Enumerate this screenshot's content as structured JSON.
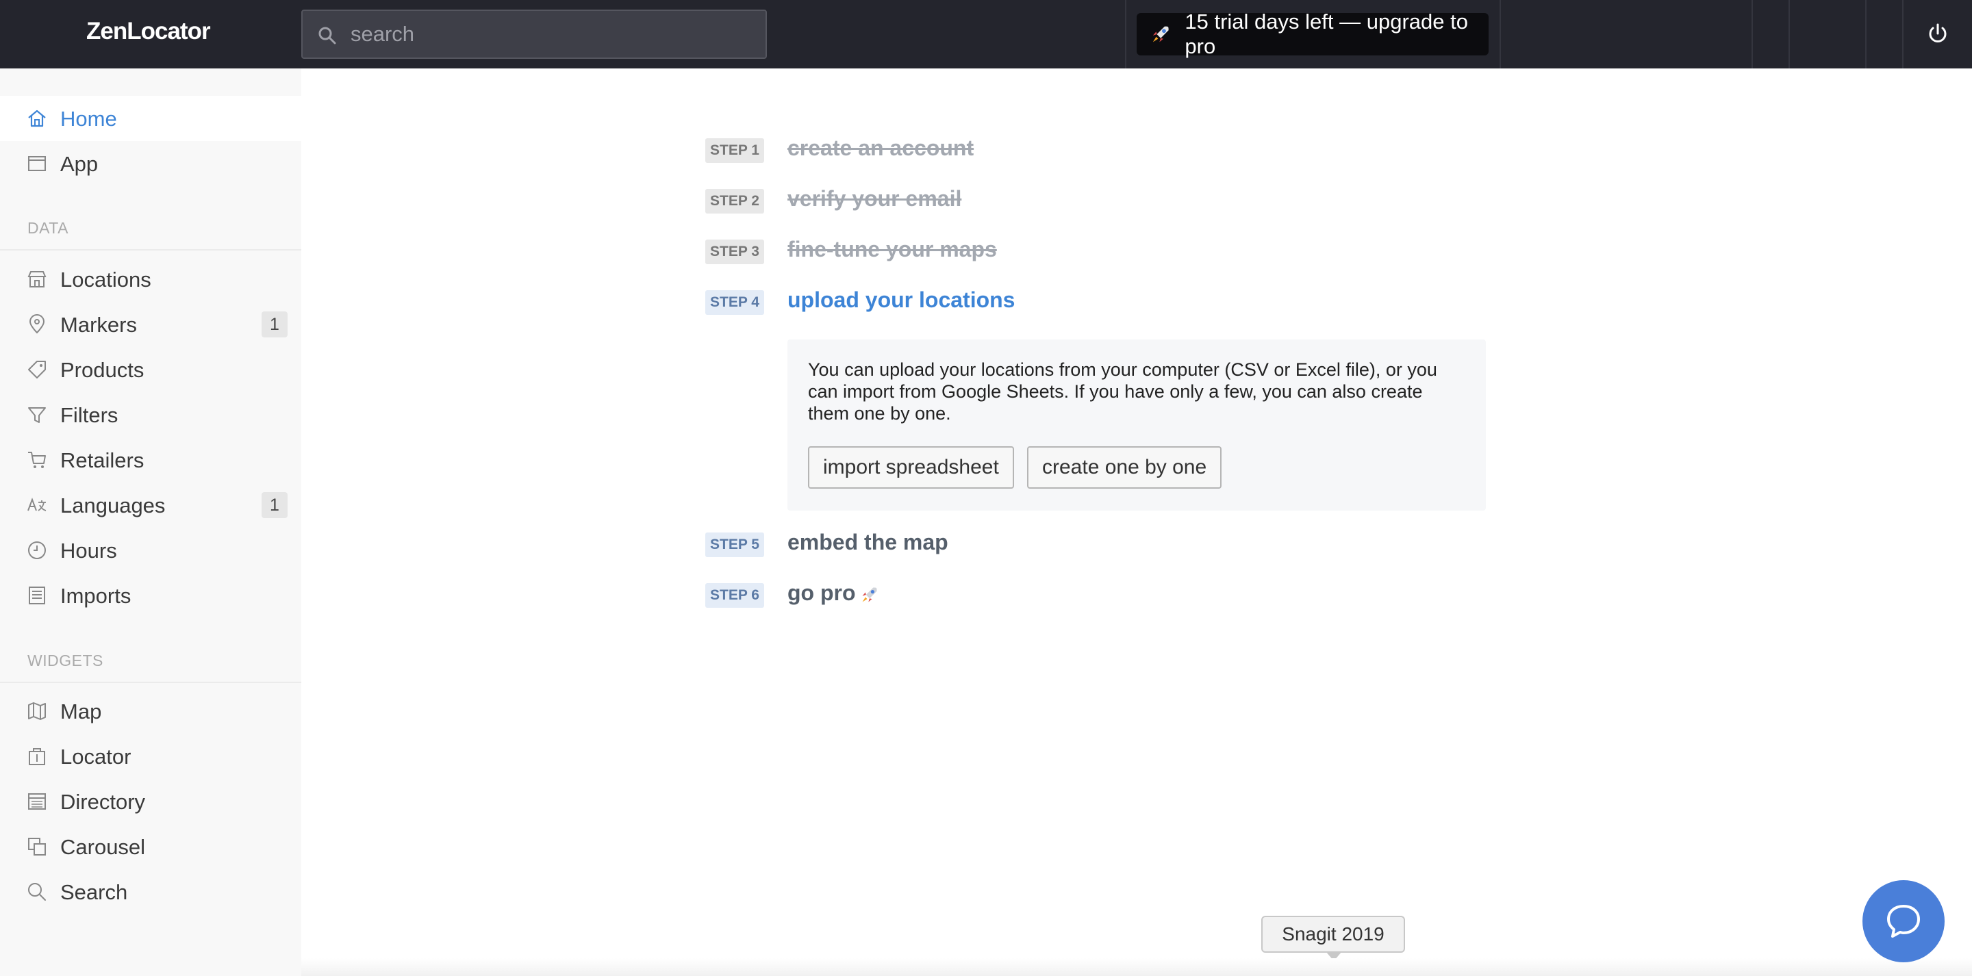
{
  "brand": "ZenLocator",
  "search": {
    "placeholder": "search"
  },
  "trial_banner": "15 trial days left — upgrade to pro",
  "sidebar": {
    "top_items": [
      {
        "label": "Home",
        "icon": "home-icon",
        "active": true
      },
      {
        "label": "App",
        "icon": "app-window-icon"
      }
    ],
    "data_section": "DATA",
    "data_items": [
      {
        "label": "Locations",
        "icon": "store-icon"
      },
      {
        "label": "Markers",
        "icon": "map-pin-icon",
        "badge": "1"
      },
      {
        "label": "Products",
        "icon": "tag-icon"
      },
      {
        "label": "Filters",
        "icon": "filter-icon"
      },
      {
        "label": "Retailers",
        "icon": "cart-icon"
      },
      {
        "label": "Languages",
        "icon": "translate-icon",
        "badge": "1"
      },
      {
        "label": "Hours",
        "icon": "clock-icon"
      },
      {
        "label": "Imports",
        "icon": "import-icon"
      }
    ],
    "widgets_section": "WIDGETS",
    "widget_items": [
      {
        "label": "Map",
        "icon": "map-icon"
      },
      {
        "label": "Locator",
        "icon": "locator-icon"
      },
      {
        "label": "Directory",
        "icon": "directory-icon"
      },
      {
        "label": "Carousel",
        "icon": "carousel-icon"
      },
      {
        "label": "Search",
        "icon": "search-icon"
      }
    ]
  },
  "steps": [
    {
      "tag": "STEP 1",
      "title": "create an account",
      "state": "done"
    },
    {
      "tag": "STEP 2",
      "title": "verify your email",
      "state": "done"
    },
    {
      "tag": "STEP 3",
      "title": "fine-tune your maps",
      "state": "done"
    },
    {
      "tag": "STEP 4",
      "title": "upload your locations",
      "state": "current"
    },
    {
      "tag": "STEP 5",
      "title": "embed the map",
      "state": "todo"
    },
    {
      "tag": "STEP 6",
      "title": "go pro",
      "state": "todo"
    }
  ],
  "upload_box": {
    "text": "You can upload your locations from your computer (CSV or Excel file), or you can import from Google Sheets. If you have only a few, you can also create them one by one.",
    "import_button": "import spreadsheet",
    "create_button": "create one by one"
  },
  "tooltip": "Snagit 2019",
  "colors": {
    "topbar": "#24252d",
    "accent": "#3d84d6",
    "chat": "#4a7fd9"
  }
}
